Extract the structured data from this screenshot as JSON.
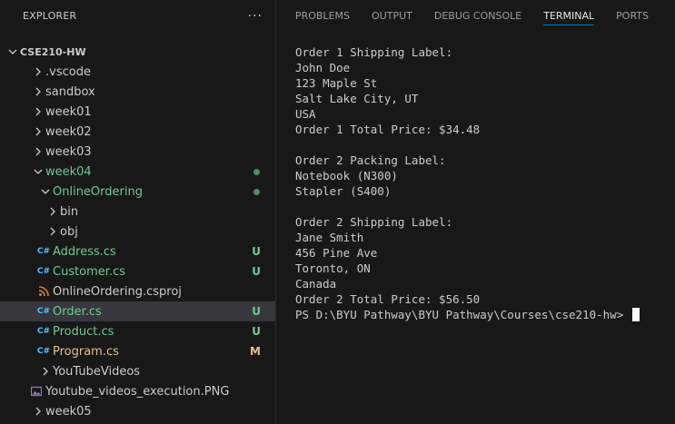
{
  "explorer": {
    "title": "EXPLORER",
    "more": "···",
    "root": "CSE210-HW",
    "items": [
      {
        "label": ".vscode",
        "type": "folder",
        "level": 1,
        "open": false,
        "color": "default",
        "status": ""
      },
      {
        "label": "sandbox",
        "type": "folder",
        "level": 1,
        "open": false,
        "color": "default",
        "status": ""
      },
      {
        "label": "week01",
        "type": "folder",
        "level": 1,
        "open": false,
        "color": "default",
        "status": ""
      },
      {
        "label": "week02",
        "type": "folder",
        "level": 1,
        "open": false,
        "color": "default",
        "status": ""
      },
      {
        "label": "week03",
        "type": "folder",
        "level": 1,
        "open": false,
        "color": "default",
        "status": ""
      },
      {
        "label": "week04",
        "type": "folder",
        "level": 1,
        "open": true,
        "color": "green",
        "status": "dot"
      },
      {
        "label": "OnlineOrdering",
        "type": "folder",
        "level": 2,
        "open": true,
        "color": "green",
        "status": "dot"
      },
      {
        "label": "bin",
        "type": "folder",
        "level": 3,
        "open": false,
        "color": "default",
        "status": ""
      },
      {
        "label": "obj",
        "type": "folder",
        "level": 3,
        "open": false,
        "color": "default",
        "status": ""
      },
      {
        "label": "Address.cs",
        "type": "cs",
        "level": 3,
        "color": "green",
        "status": "U"
      },
      {
        "label": "Customer.cs",
        "type": "cs",
        "level": 3,
        "color": "green",
        "status": "U"
      },
      {
        "label": "OnlineOrdering.csproj",
        "type": "rss",
        "level": 3,
        "color": "default",
        "status": ""
      },
      {
        "label": "Order.cs",
        "type": "cs",
        "level": 3,
        "color": "green",
        "status": "U",
        "selected": true
      },
      {
        "label": "Product.cs",
        "type": "cs",
        "level": 3,
        "color": "green",
        "status": "U"
      },
      {
        "label": "Program.cs",
        "type": "cs",
        "level": 3,
        "color": "amber",
        "status": "M"
      },
      {
        "label": "YouTubeVideos",
        "type": "folder",
        "level": 2,
        "open": false,
        "color": "default",
        "status": ""
      },
      {
        "label": "Youtube_videos_execution.PNG",
        "type": "img",
        "level": 2,
        "color": "default",
        "status": ""
      },
      {
        "label": "week05",
        "type": "folder",
        "level": 1,
        "open": false,
        "color": "default",
        "status": ""
      }
    ]
  },
  "panel": {
    "tabs": [
      {
        "label": "PROBLEMS",
        "active": false
      },
      {
        "label": "OUTPUT",
        "active": false
      },
      {
        "label": "DEBUG CONSOLE",
        "active": false
      },
      {
        "label": "TERMINAL",
        "active": true
      },
      {
        "label": "PORTS",
        "active": false
      }
    ],
    "terminal_lines": [
      "Order 1 Shipping Label:",
      "John Doe",
      "123 Maple St",
      "Salt Lake City, UT",
      "USA",
      "Order 1 Total Price: $34.48",
      "",
      "Order 2 Packing Label:",
      "Notebook (N300)",
      "Stapler (S400)",
      "",
      "Order 2 Shipping Label:",
      "Jane Smith",
      "456 Pine Ave",
      "Toronto, ON",
      "Canada",
      "Order 2 Total Price: $56.50"
    ],
    "prompt": "PS D:\\BYU Pathway\\BYU Pathway\\Courses\\cse210-hw> "
  },
  "colors": {
    "background": "#181818",
    "selected_row": "#37373d",
    "untracked": "#73c991",
    "modified": "#e2c08d",
    "cs_icon": "#4fc1ff",
    "rss_icon": "#e37933",
    "image_icon": "#a074c4",
    "active_tab_underline": "#0078d4"
  }
}
